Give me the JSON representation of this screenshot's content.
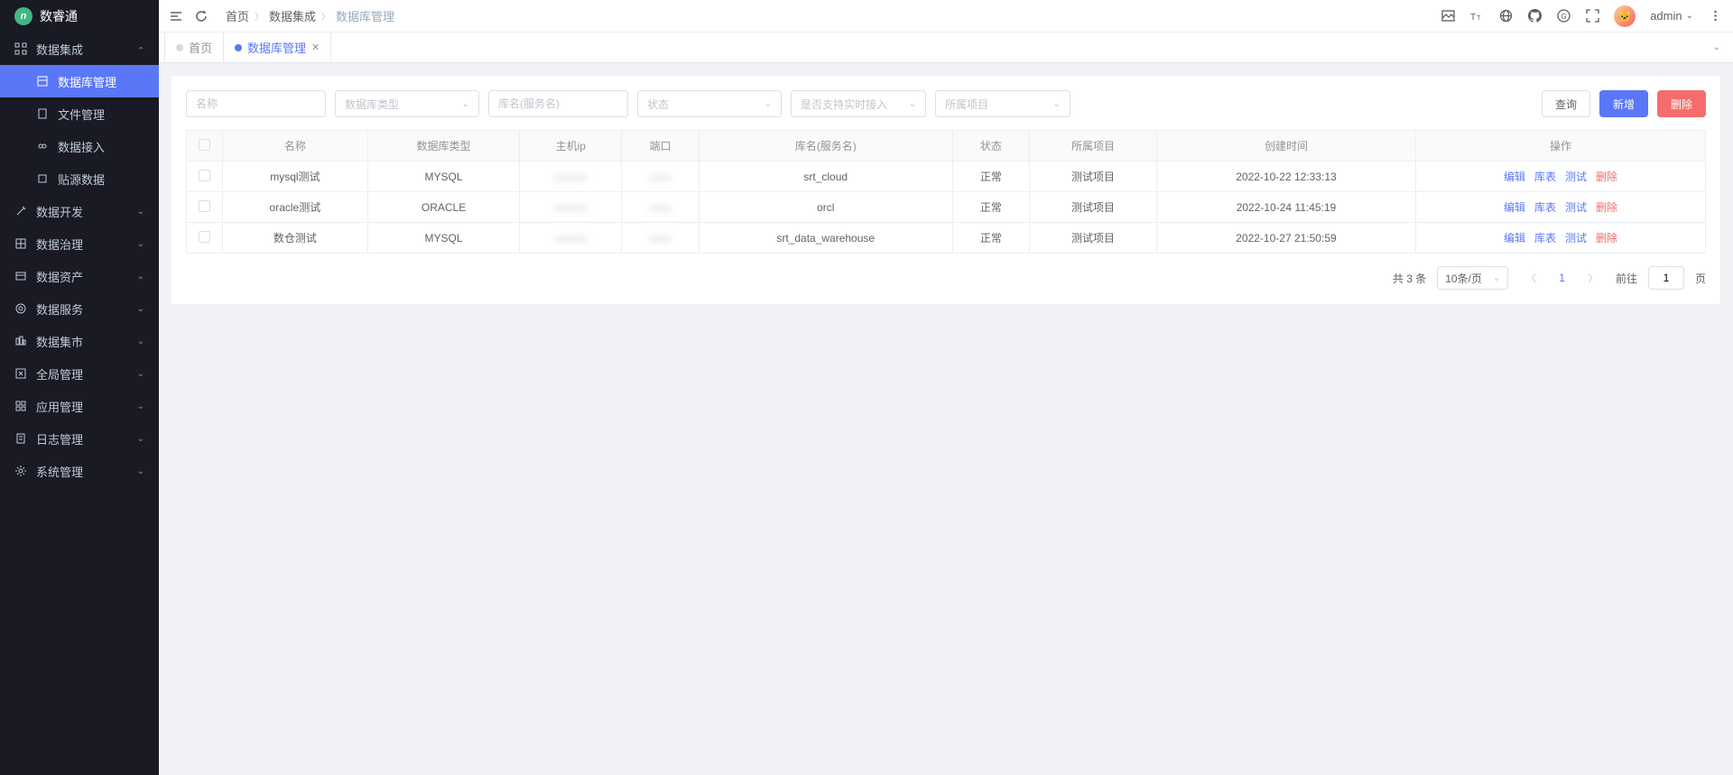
{
  "brand": {
    "logo": "n",
    "name": "数睿通"
  },
  "sidebar": {
    "items": [
      {
        "label": "数据集成",
        "type": "group",
        "expanded": true
      },
      {
        "label": "数据库管理",
        "type": "sub",
        "active": true
      },
      {
        "label": "文件管理",
        "type": "sub"
      },
      {
        "label": "数据接入",
        "type": "sub"
      },
      {
        "label": "贴源数据",
        "type": "sub"
      },
      {
        "label": "数据开发",
        "type": "group"
      },
      {
        "label": "数据治理",
        "type": "group"
      },
      {
        "label": "数据资产",
        "type": "group"
      },
      {
        "label": "数据服务",
        "type": "group"
      },
      {
        "label": "数据集市",
        "type": "group"
      },
      {
        "label": "全局管理",
        "type": "group"
      },
      {
        "label": "应用管理",
        "type": "group"
      },
      {
        "label": "日志管理",
        "type": "group"
      },
      {
        "label": "系统管理",
        "type": "group"
      }
    ]
  },
  "breadcrumb": [
    "首页",
    "数据集成",
    "数据库管理"
  ],
  "user": {
    "name": "admin"
  },
  "tabs": [
    {
      "label": "首页",
      "active": false,
      "closable": false
    },
    {
      "label": "数据库管理",
      "active": true,
      "closable": true
    }
  ],
  "filters": {
    "name_placeholder": "名称",
    "dbtype_placeholder": "数据库类型",
    "dbname_placeholder": "库名(服务名)",
    "status_placeholder": "状态",
    "realtime_placeholder": "是否支持实时接入",
    "project_placeholder": "所属项目"
  },
  "buttons": {
    "search": "查询",
    "add": "新增",
    "delete": "删除"
  },
  "table": {
    "headers": [
      "名称",
      "数据库类型",
      "主机ip",
      "端口",
      "库名(服务名)",
      "状态",
      "所属项目",
      "创建时间",
      "操作"
    ],
    "ops": {
      "edit": "编辑",
      "tables": "库表",
      "test": "测试",
      "delete": "删除"
    },
    "rows": [
      {
        "name": "mysql测试",
        "dbtype": "MYSQL",
        "host": "———",
        "port": "——",
        "dbname": "srt_cloud",
        "status": "正常",
        "project": "测试项目",
        "created": "2022-10-22 12:33:13"
      },
      {
        "name": "oracle测试",
        "dbtype": "ORACLE",
        "host": "———",
        "port": "——",
        "dbname": "orcl",
        "status": "正常",
        "project": "测试项目",
        "created": "2022-10-24 11:45:19"
      },
      {
        "name": "数仓测试",
        "dbtype": "MYSQL",
        "host": "———",
        "port": "——",
        "dbname": "srt_data_warehouse",
        "status": "正常",
        "project": "测试项目",
        "created": "2022-10-27 21:50:59"
      }
    ]
  },
  "pagination": {
    "total_text": "共 3 条",
    "per_page": "10条/页",
    "current": "1",
    "goto_label": "前往",
    "goto_value": "1",
    "page_suffix": "页"
  }
}
